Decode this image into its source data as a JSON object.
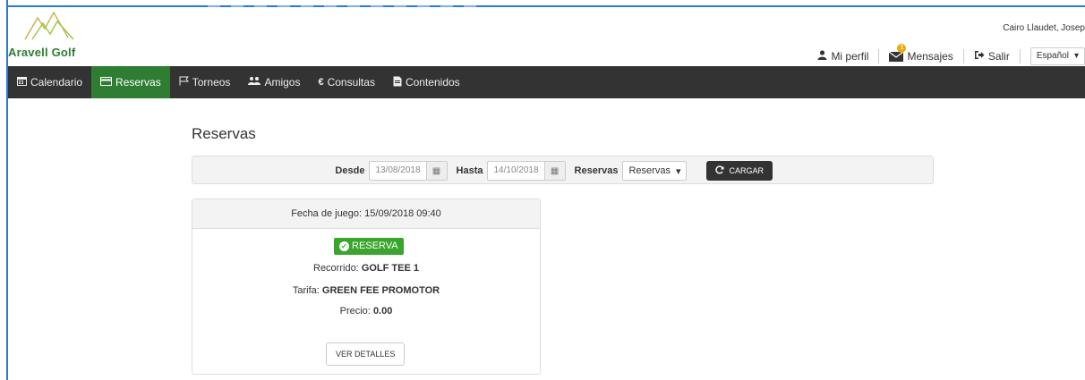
{
  "brand": {
    "name": "Aravell Golf",
    "color": "#2e7d32"
  },
  "user": {
    "name": "Cairo Llaudet, Josep"
  },
  "topnav": {
    "profile_label": "Mi perfil",
    "messages_label": "Mensajes",
    "messages_count": "1",
    "logout_label": "Salir",
    "language": "Español"
  },
  "nav": {
    "items": [
      {
        "label": "Calendario",
        "icon": "calendar-icon"
      },
      {
        "label": "Reservas",
        "icon": "credit-card-icon",
        "active": true
      },
      {
        "label": "Torneos",
        "icon": "flag-icon"
      },
      {
        "label": "Amigos",
        "icon": "users-icon"
      },
      {
        "label": "Consultas",
        "icon": "euro-icon"
      },
      {
        "label": "Contenidos",
        "icon": "file-icon"
      }
    ]
  },
  "page": {
    "title": "Reservas"
  },
  "filters": {
    "from_label": "Desde",
    "from_value": "13/08/2018",
    "to_label": "Hasta",
    "to_value": "14/10/2018",
    "type_label": "Reservas",
    "type_value": "Reservas",
    "load_label": "CARGAR"
  },
  "reservation": {
    "header": "Fecha de juego: 15/09/2018 09:40",
    "status": "RESERVA",
    "status_color": "#3aa52d",
    "course_label": "Recorrido:",
    "course_value": "GOLF TEE 1",
    "rate_label": "Tarifa:",
    "rate_value": "GREEN FEE PROMOTOR",
    "price_label": "Precio:",
    "price_value": "0.00",
    "details_label": "VER DETALLES"
  }
}
